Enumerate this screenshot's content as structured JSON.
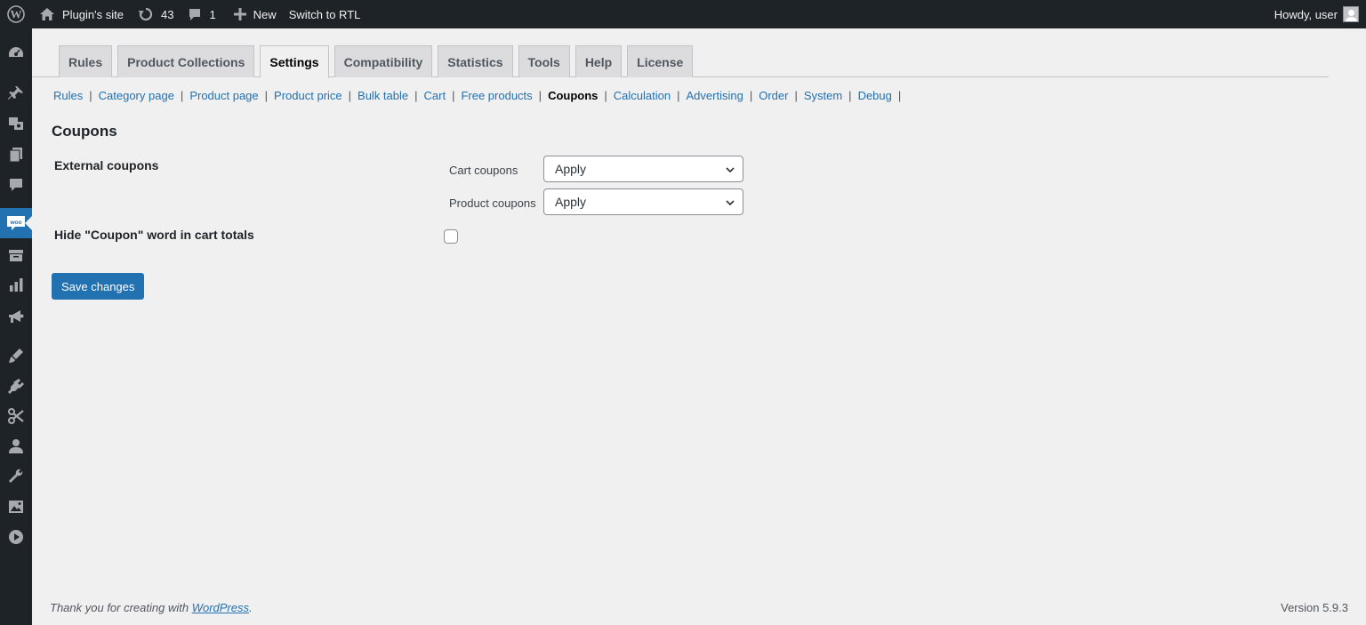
{
  "admin_bar": {
    "wp_logo_icon": "wordpress-logo-icon",
    "site_name": "Plugin's site",
    "updates_count": "43",
    "comments_count": "1",
    "new_label": "New",
    "rtl_label": "Switch to RTL",
    "howdy": "Howdy, user"
  },
  "admin_menu": {
    "icons": [
      "dashboard-icon",
      "pin-icon",
      "media-icon",
      "pages-icon",
      "comments-icon",
      "woocommerce-icon",
      "products-icon",
      "analytics-icon",
      "marketing-icon",
      "appearance-icon",
      "plugins-icon",
      "tools-icon",
      "users-icon",
      "settings-icon",
      "media-library-icon",
      "play-icon"
    ]
  },
  "tabs": [
    "Rules",
    "Product Collections",
    "Settings",
    "Compatibility",
    "Statistics",
    "Tools",
    "Help",
    "License"
  ],
  "active_tab": "Settings",
  "subnav": [
    "Rules",
    "Category page",
    "Product page",
    "Product price",
    "Bulk table",
    "Cart",
    "Free products",
    "Coupons",
    "Calculation",
    "Advertising",
    "Order",
    "System",
    "Debug"
  ],
  "active_subnav": "Coupons",
  "section_title": "Coupons",
  "form": {
    "external_coupons_label": "External coupons",
    "cart_coupons_label": "Cart coupons",
    "cart_coupons_value": "Apply",
    "product_coupons_label": "Product coupons",
    "product_coupons_value": "Apply",
    "hide_coupon_label": "Hide \"Coupon\" word in cart totals",
    "hide_coupon_checked": false,
    "save_label": "Save changes"
  },
  "footer": {
    "thanks_prefix": "Thank you for creating with ",
    "thanks_link": "WordPress",
    "thanks_suffix": ".",
    "version": "Version 5.9.3"
  },
  "colors": {
    "admin_bar_bg": "#1d2327",
    "accent": "#2271b1",
    "page_bg": "#f0f0f1"
  }
}
